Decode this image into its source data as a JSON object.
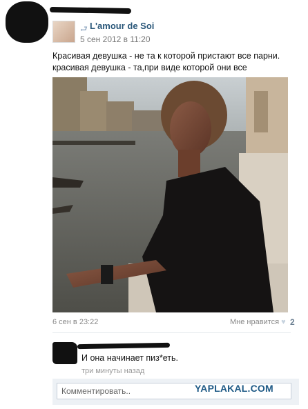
{
  "repost": {
    "icon": "repost-arrow-icon",
    "author": "L'amour de Soi",
    "date": "5 сен 2012 в 11:20"
  },
  "post": {
    "text_line1": "Красивая девушка - не та к которой пристают все парни.",
    "text_line2": "красивая девушка - та,при виде которой они все замолкают."
  },
  "footer": {
    "date": "6 сен в 23:22",
    "like_label": "Мне нравится",
    "like_icon": "heart-icon",
    "like_count": "2"
  },
  "comment": {
    "text": "И она начинает пиз*еть.",
    "time": "три минуты назад"
  },
  "reply": {
    "placeholder": "Комментировать.."
  },
  "watermark": "YAPLAKAL.COM",
  "colors": {
    "link": "#2b587a",
    "muted": "#888888",
    "reply_bg": "#edf1f5"
  }
}
